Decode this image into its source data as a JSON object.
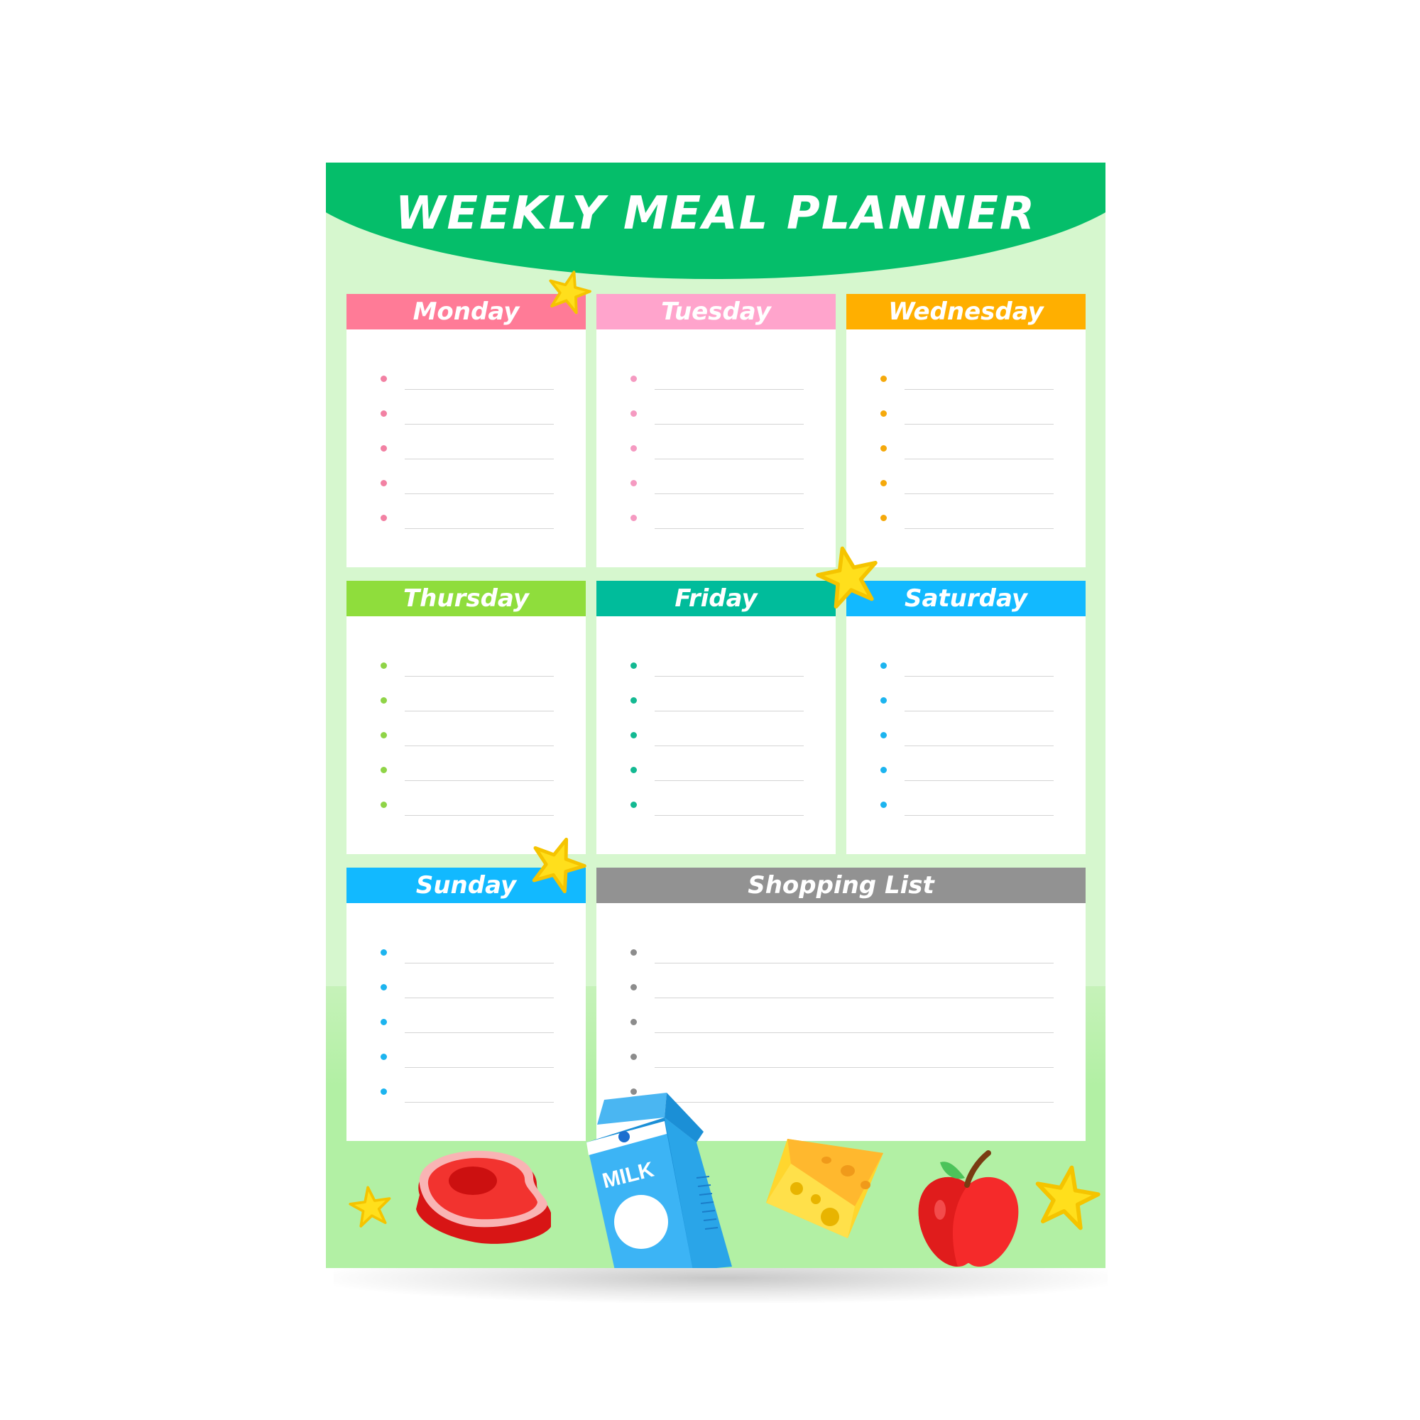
{
  "title": "WEEKLY MEAL PLANNER",
  "colors": {
    "header": "#05be6a",
    "sheet": "#d6f7ce",
    "monday": "#ff7b97",
    "tuesday": "#ffa4cc",
    "wednesday": "#ffaf00",
    "thursday": "#8fdd3c",
    "friday": "#00bc9b",
    "saturday": "#12b9ff",
    "sunday": "#12b9ff",
    "shopping": "#929292"
  },
  "days": [
    {
      "label": "Monday"
    },
    {
      "label": "Tuesday"
    },
    {
      "label": "Wednesday"
    },
    {
      "label": "Thursday"
    },
    {
      "label": "Friday"
    },
    {
      "label": "Saturday"
    },
    {
      "label": "Sunday"
    }
  ],
  "shopping": {
    "label": "Shopping List"
  },
  "lines_per_card": 5,
  "illustrations": {
    "milk_label": "MILK",
    "items": [
      "steak-icon",
      "milk-carton-icon",
      "cheese-icon",
      "apple-icon",
      "star-icon"
    ]
  }
}
